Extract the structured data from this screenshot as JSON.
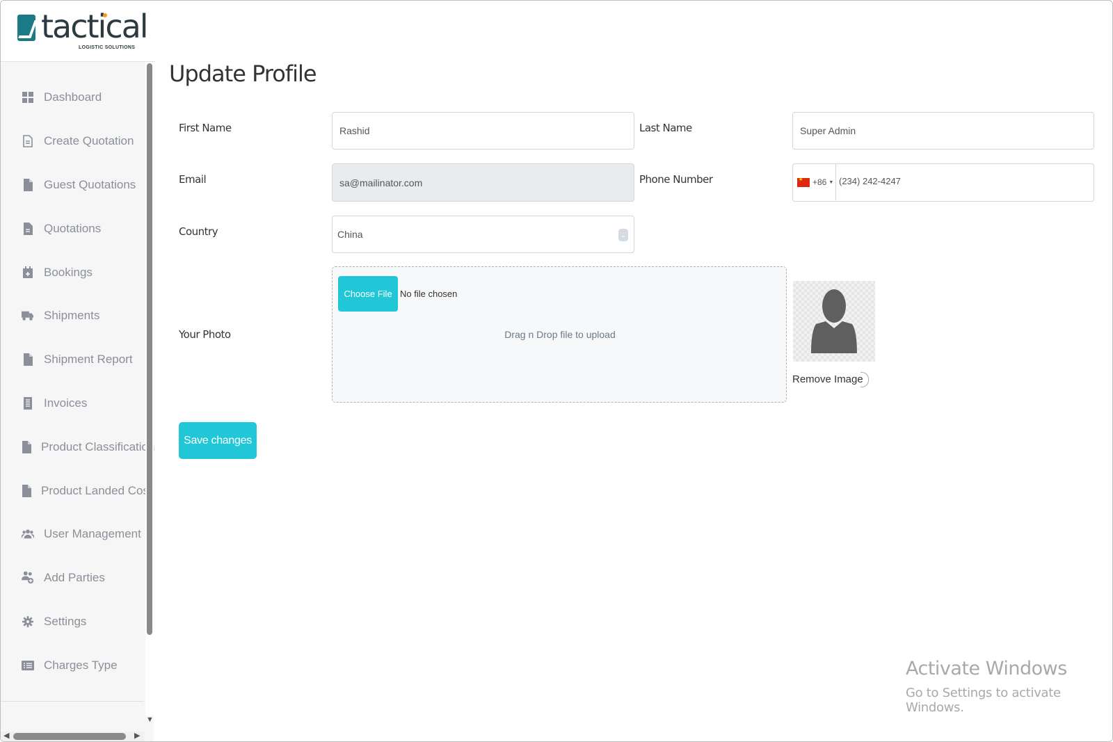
{
  "brand": {
    "name": "tactical",
    "tagline": "LOGISTIC SOLUTIONS"
  },
  "sidebar": {
    "items": [
      {
        "label": "Dashboard",
        "icon": "grid-icon"
      },
      {
        "label": "Create Quotation",
        "icon": "document-outline-icon"
      },
      {
        "label": "Guest Quotations",
        "icon": "file-icon"
      },
      {
        "label": "Quotations",
        "icon": "file-text-icon"
      },
      {
        "label": "Bookings",
        "icon": "calendar-plus-icon"
      },
      {
        "label": "Shipments",
        "icon": "truck-icon"
      },
      {
        "label": "Shipment Report",
        "icon": "file-icon"
      },
      {
        "label": "Invoices",
        "icon": "receipt-icon"
      },
      {
        "label": "Product Classification",
        "icon": "file-icon"
      },
      {
        "label": "Product Landed Cost",
        "icon": "file-icon"
      },
      {
        "label": "User Management",
        "icon": "users-icon"
      },
      {
        "label": "Add Parties",
        "icon": "users-plus-icon"
      },
      {
        "label": "Settings",
        "icon": "gear-icon"
      },
      {
        "label": "Charges Type",
        "icon": "list-icon"
      }
    ]
  },
  "page": {
    "title": "Update Profile"
  },
  "form": {
    "first_name": {
      "label": "First Name",
      "value": "Rashid"
    },
    "last_name": {
      "label": "Last Name",
      "value": "Super Admin"
    },
    "email": {
      "label": "Email",
      "value": "sa@mailinator.com"
    },
    "phone": {
      "label": "Phone Number",
      "dial_code": "+86",
      "value": "(234) 242-4247"
    },
    "country": {
      "label": "Country",
      "value": "China"
    },
    "photo": {
      "label": "Your Photo",
      "choose_label": "Choose File",
      "no_file": "No file chosen",
      "drop_hint": "Drag n Drop file to upload",
      "remove_label": "Remove Image"
    },
    "save_label": "Save changes"
  },
  "watermark": {
    "title": "Activate Windows",
    "subtitle": "Go to Settings to activate Windows."
  },
  "colors": {
    "accent": "#21c7d6",
    "sidebar_text": "#8a8f99"
  }
}
